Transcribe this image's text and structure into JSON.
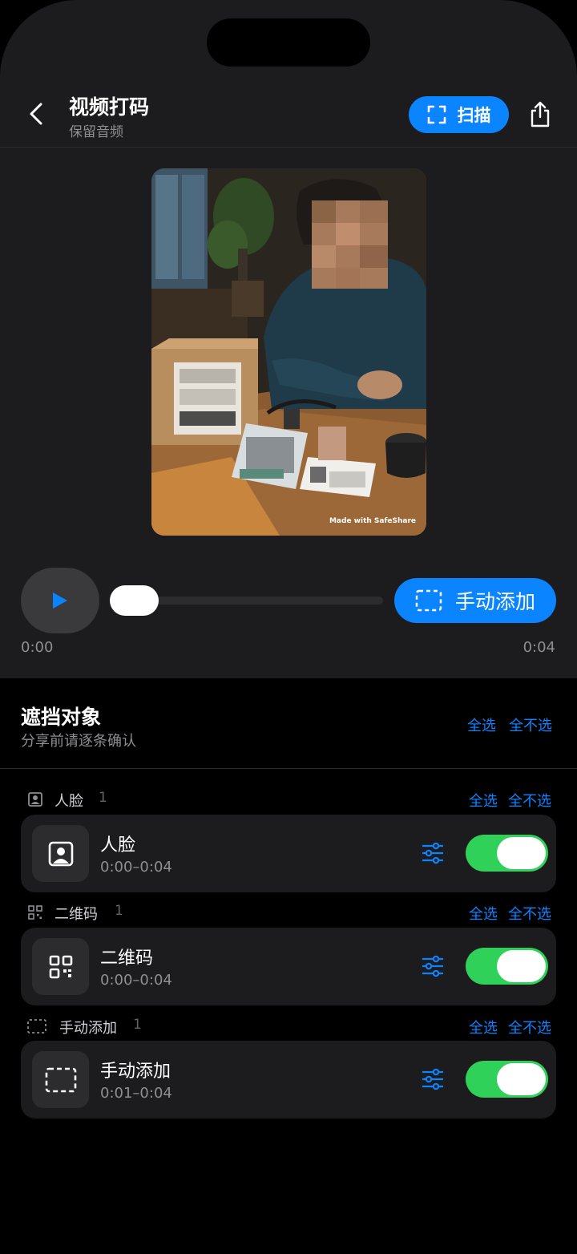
{
  "header": {
    "title": "视频打码",
    "subtitle": "保留音频",
    "scan_label": "扫描"
  },
  "video": {
    "watermark": "Made with SafeShare"
  },
  "player": {
    "manual_add_label": "手动添加",
    "time_current": "0:00",
    "time_total": "0:04",
    "progress": 0
  },
  "objects": {
    "title": "遮挡对象",
    "subtitle": "分享前请逐条确认",
    "select_all": "全选",
    "select_none": "全不选"
  },
  "groups": [
    {
      "label": "人脸",
      "count": "1",
      "icon": "face-icon",
      "select_all": "全选",
      "select_none": "全不选",
      "item": {
        "title": "人脸",
        "time": "0:00–0:04",
        "enabled": true
      }
    },
    {
      "label": "二维码",
      "count": "1",
      "icon": "qr-code-icon",
      "select_all": "全选",
      "select_none": "全不选",
      "item": {
        "title": "二维码",
        "time": "0:00–0:04",
        "enabled": true
      }
    },
    {
      "label": "手动添加",
      "count": "1",
      "icon": "dashed-box-icon",
      "select_all": "全选",
      "select_none": "全不选",
      "item": {
        "title": "手动添加",
        "time": "0:01–0:04",
        "enabled": true
      }
    }
  ],
  "colors": {
    "accent": "#0a84ff",
    "toggle_on": "#30d158",
    "background": "#000000",
    "surface": "#1c1c1e"
  }
}
